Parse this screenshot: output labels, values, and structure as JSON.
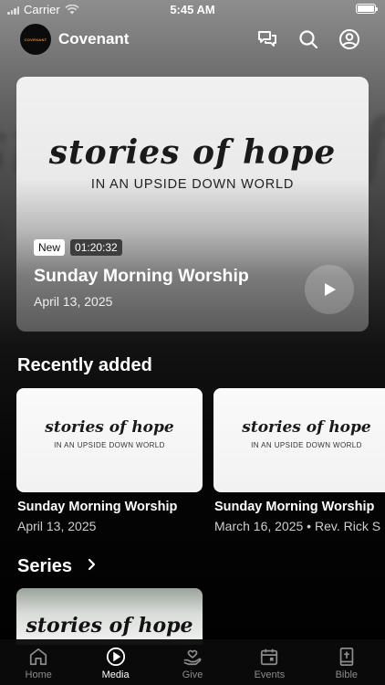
{
  "status": {
    "carrier": "Carrier",
    "time": "5:45 AM"
  },
  "header": {
    "title": "Covenant",
    "logo_text": "COVENANT"
  },
  "hero": {
    "script": "stories of hope",
    "subtitle": "IN AN UPSIDE DOWN WORLD",
    "badge_new": "New",
    "duration": "01:20:32",
    "title": "Sunday Morning Worship",
    "date": "April 13, 2025"
  },
  "recent": {
    "heading": "Recently added",
    "items": [
      {
        "script": "stories of hope",
        "subtitle": "IN AN UPSIDE DOWN WORLD",
        "title": "Sunday Morning Worship",
        "meta": "April 13, 2025"
      },
      {
        "script": "stories of hope",
        "subtitle": "IN AN UPSIDE DOWN WORLD",
        "title": "Sunday Morning Worship",
        "meta": "March 16, 2025 • Rev. Rick S"
      }
    ]
  },
  "series": {
    "heading": "Series",
    "card_script": "stories of hope"
  },
  "tabs": [
    {
      "label": "Home",
      "icon": "home-icon"
    },
    {
      "label": "Media",
      "icon": "play-circle-icon"
    },
    {
      "label": "Give",
      "icon": "give-heart-icon"
    },
    {
      "label": "Events",
      "icon": "calendar-icon"
    },
    {
      "label": "Bible",
      "icon": "bible-icon"
    }
  ]
}
